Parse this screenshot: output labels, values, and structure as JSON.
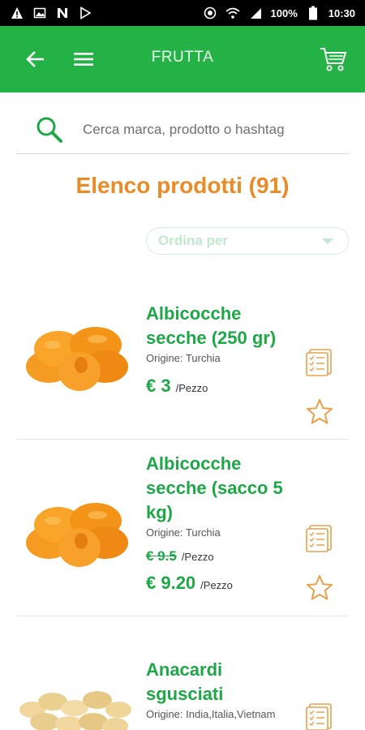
{
  "status_bar": {
    "left_icons": [
      "warning-icon",
      "image-icon",
      "n-icon",
      "play-store-icon"
    ],
    "battery": "100%",
    "time": "10:30"
  },
  "app_bar": {
    "title": "FRUTTA",
    "color": "#24b247"
  },
  "search": {
    "placeholder": "Cerca marca, prodotto o hashtag"
  },
  "list": {
    "heading": "Elenco prodotti (91)",
    "sort_label": "Ordina per"
  },
  "products": [
    {
      "name_line1": "Albicocche",
      "name_line2": "secche (250 gr)",
      "origin": "Origine: Turchia",
      "price": "€ 3",
      "unit": "/Pezzo"
    },
    {
      "name_line1": "Albicocche",
      "name_line2": "secche (sacco 5",
      "name_line3": "kg)",
      "origin": "Origine: Turchia",
      "old_price": "€ 9.5",
      "old_unit": "/Pezzo",
      "price": "€ 9.20",
      "unit": "/Pezzo"
    },
    {
      "name_line1": "Anacardi",
      "name_line2": "sgusciati",
      "origin": "Origine: India,Italia,Vietnam"
    }
  ]
}
